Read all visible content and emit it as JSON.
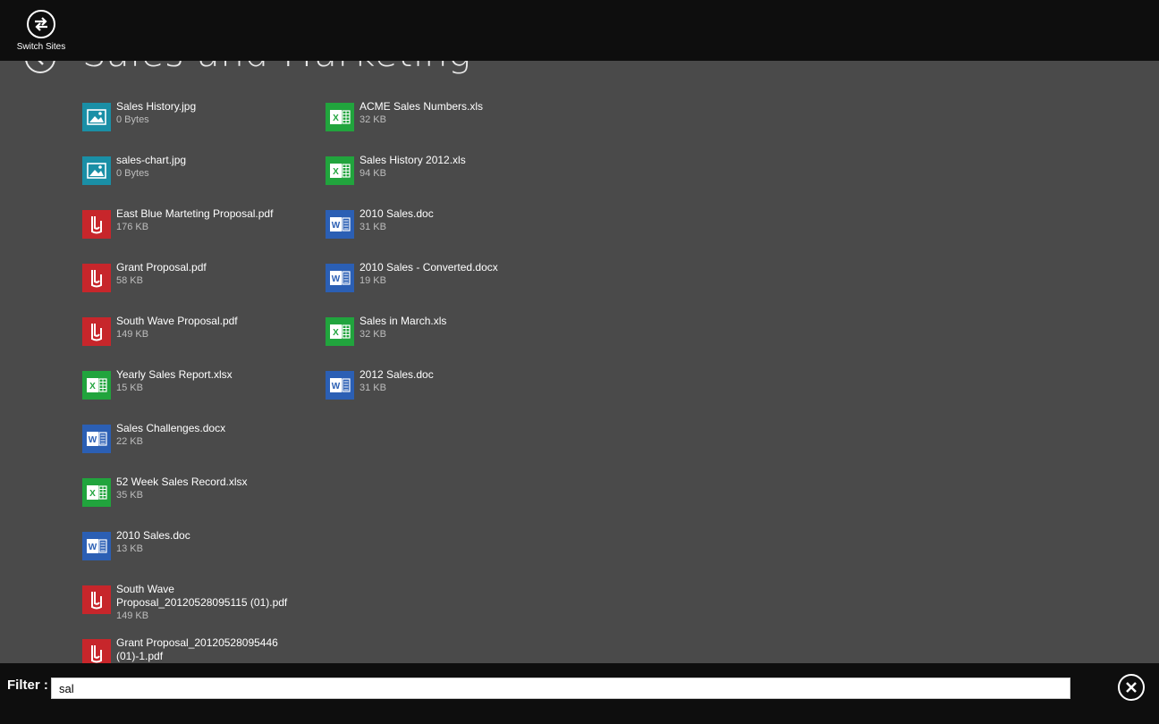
{
  "page": {
    "title": "Sales and Marketing"
  },
  "appbar": {
    "switch_label": "Switch Sites"
  },
  "files": [
    {
      "name": "Sales History.jpg",
      "size": "0 Bytes",
      "type": "image"
    },
    {
      "name": "sales-chart.jpg",
      "size": "0 Bytes",
      "type": "image"
    },
    {
      "name": "East Blue Marteting Proposal.pdf",
      "size": "176 KB",
      "type": "pdf"
    },
    {
      "name": "Grant Proposal.pdf",
      "size": "58 KB",
      "type": "pdf"
    },
    {
      "name": "South Wave Proposal.pdf",
      "size": "149 KB",
      "type": "pdf"
    },
    {
      "name": "Yearly Sales Report.xlsx",
      "size": "15 KB",
      "type": "excel"
    },
    {
      "name": "Sales Challenges.docx",
      "size": "22 KB",
      "type": "word"
    },
    {
      "name": "52 Week Sales Record.xlsx",
      "size": "35 KB",
      "type": "excel"
    },
    {
      "name": "2010 Sales.doc",
      "size": "13 KB",
      "type": "word"
    },
    {
      "name": "South Wave Proposal_20120528095115 (01).pdf",
      "size": "149 KB",
      "type": "pdf"
    },
    {
      "name": "Grant Proposal_20120528095446 (01)-1.pdf",
      "size": "",
      "type": "pdf"
    },
    {
      "name": "ACME Sales Numbers.xls",
      "size": "32 KB",
      "type": "excel"
    },
    {
      "name": "Sales History 2012.xls",
      "size": "94 KB",
      "type": "excel"
    },
    {
      "name": "2010 Sales.doc",
      "size": "31 KB",
      "type": "word"
    },
    {
      "name": "2010 Sales - Converted.docx",
      "size": "19 KB",
      "type": "word"
    },
    {
      "name": "Sales in March.xls",
      "size": "32 KB",
      "type": "excel"
    },
    {
      "name": "2012 Sales.doc",
      "size": "31 KB",
      "type": "word"
    }
  ],
  "filter": {
    "label": "Filter :",
    "value": "sal"
  },
  "icons": {
    "back": "back-arrow-icon",
    "switch": "switch-arrows-icon",
    "clear": "close-icon",
    "pdf": "pdf-file-icon",
    "image": "image-file-icon",
    "excel": "excel-file-icon",
    "word": "word-file-icon"
  },
  "colors": {
    "background": "#4a4a4a",
    "appbar": "#0e0e0e",
    "pdf": "#c7262b",
    "image": "#1a8fa6",
    "excel": "#21a43d",
    "word": "#2b5fb4"
  }
}
